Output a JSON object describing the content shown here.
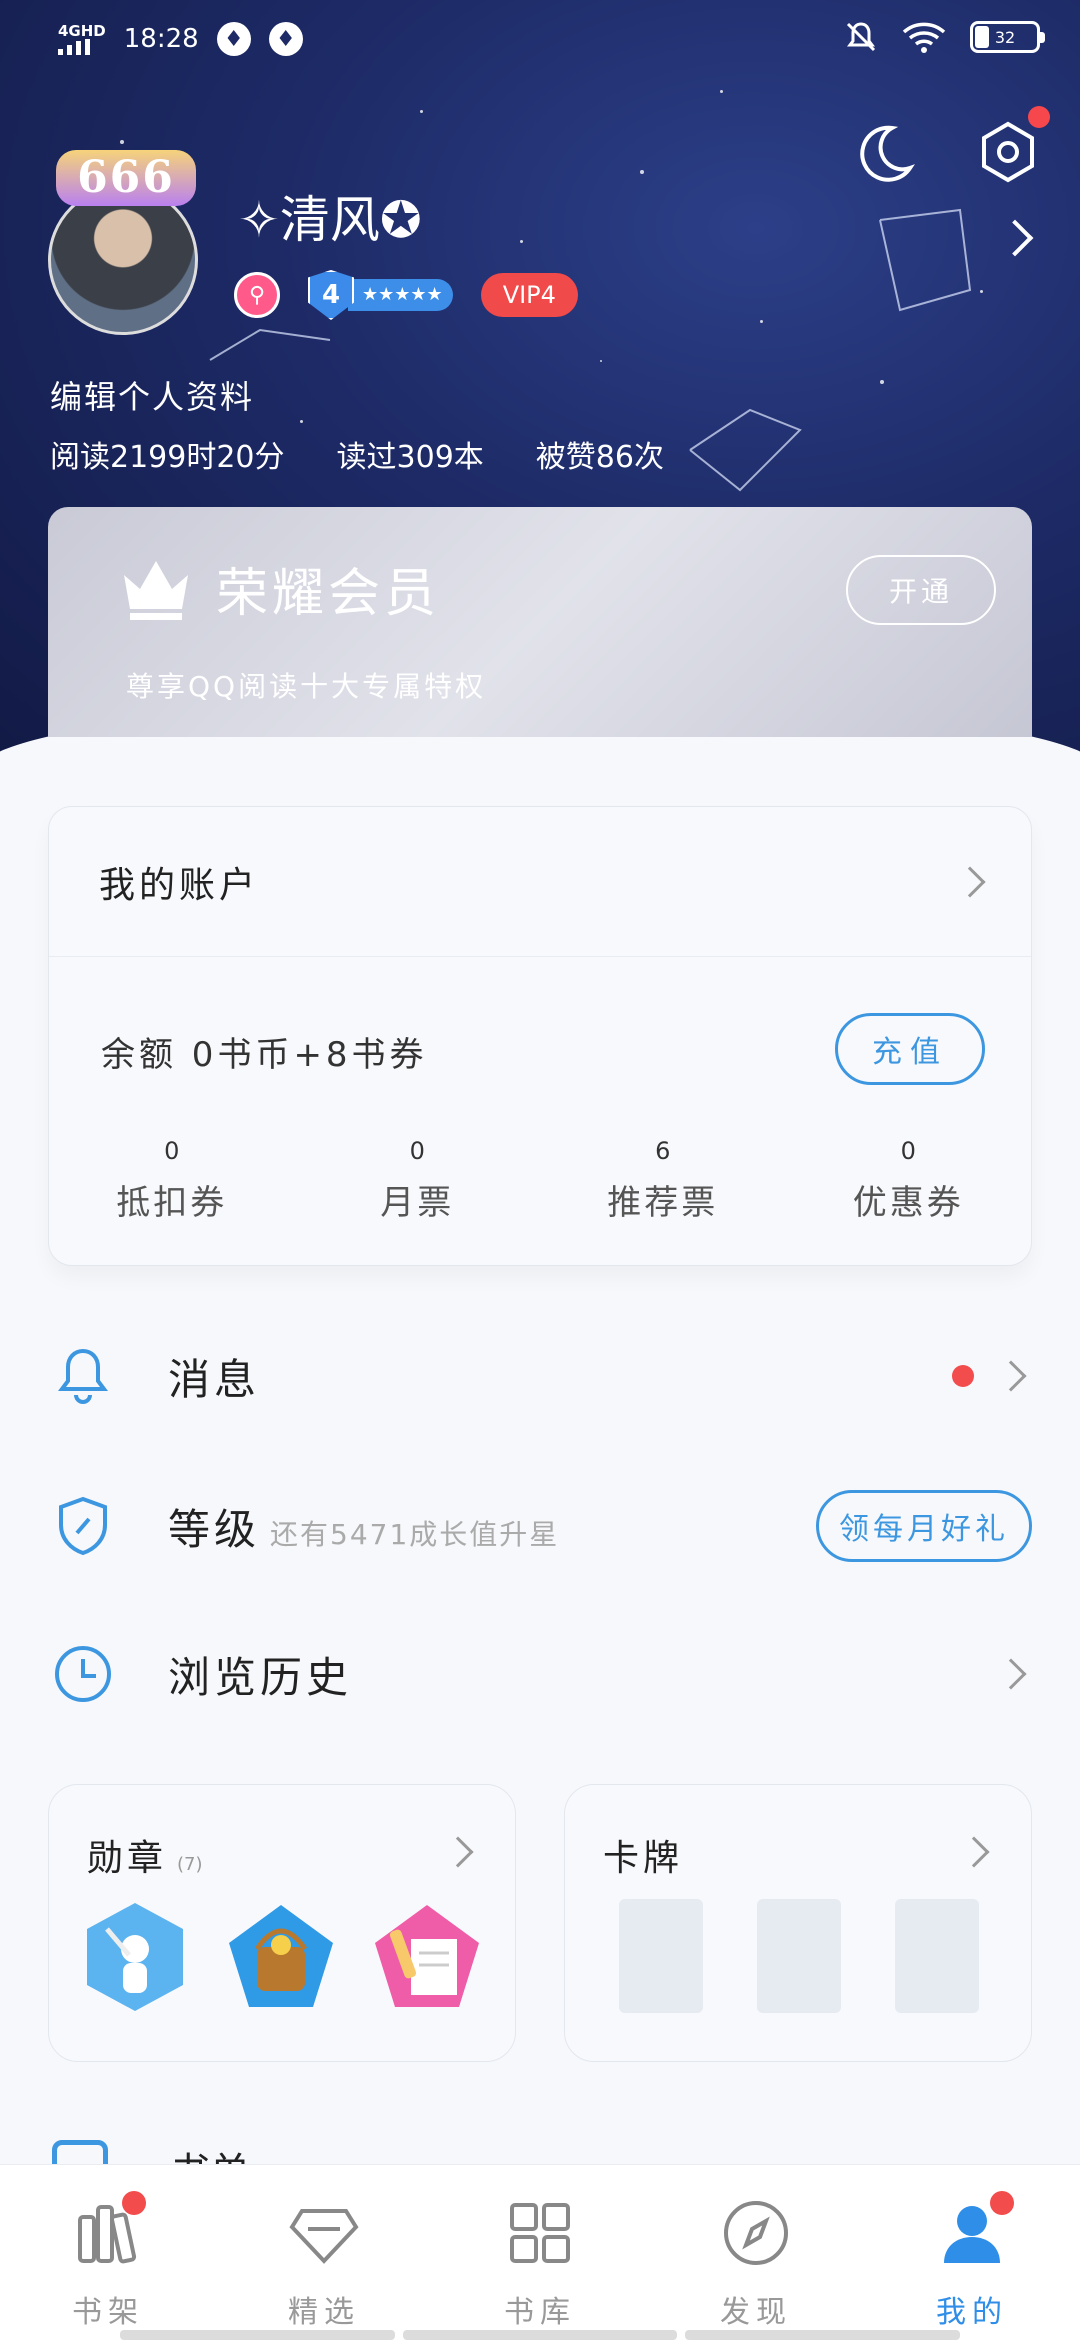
{
  "status_bar": {
    "network": "4GHD",
    "time": "18:28",
    "battery": "32"
  },
  "profile": {
    "avatar_badge": "666",
    "nickname": "✧清风✪",
    "level": "4",
    "level_stars": "★★★★★",
    "vip_tag": "VIP4",
    "edit_label": "编辑个人资料",
    "stats": [
      "阅读2199时20分",
      "读过309本",
      "被赞86次"
    ]
  },
  "vip_card": {
    "title": "荣耀会员",
    "subtitle": "尊享QQ阅读十大专属特权",
    "button": "开通"
  },
  "account": {
    "title": "我的账户",
    "balance": "余额 0书币+8书券",
    "recharge": "充值",
    "tickets": [
      {
        "count": "0",
        "label": "抵扣券"
      },
      {
        "count": "0",
        "label": "月票"
      },
      {
        "count": "6",
        "label": "推荐票"
      },
      {
        "count": "0",
        "label": "优惠券"
      }
    ]
  },
  "rows": {
    "messages": "消息",
    "level": "等级",
    "level_hint": "还有5471成长值升星",
    "level_button": "领每月好礼",
    "history": "浏览历史"
  },
  "medals": {
    "title": "勋章",
    "count": "(7)"
  },
  "cards": {
    "title": "卡牌"
  },
  "partial_row": "书单",
  "nav": [
    {
      "label": "书架",
      "icon": "bookshelf-icon"
    },
    {
      "label": "精选",
      "icon": "diamond-icon"
    },
    {
      "label": "书库",
      "icon": "grid-icon"
    },
    {
      "label": "发现",
      "icon": "compass-icon"
    },
    {
      "label": "我的",
      "icon": "person-icon"
    }
  ],
  "colors": {
    "accent": "#2f8ee8",
    "alert": "#f24c4c",
    "vip": "#f04a4a",
    "header_bg": "#1d2a66"
  }
}
